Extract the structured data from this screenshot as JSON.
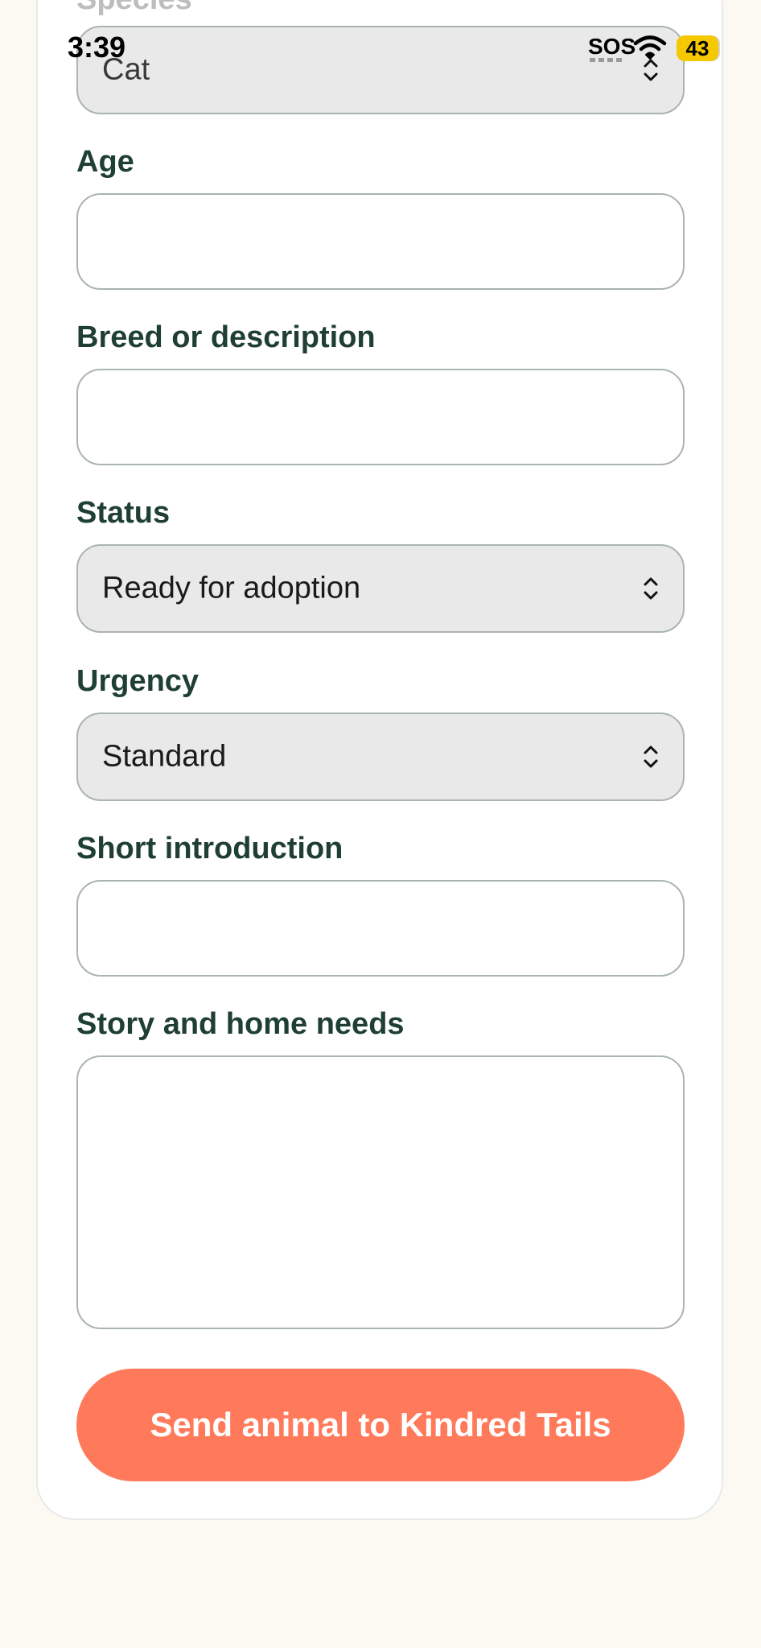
{
  "status_bar": {
    "time": "3:39",
    "sos": "SOS",
    "battery": "43"
  },
  "form": {
    "species": {
      "label": "Species",
      "value": "Cat"
    },
    "age": {
      "label": "Age",
      "value": ""
    },
    "breed": {
      "label": "Breed or description",
      "value": ""
    },
    "status": {
      "label": "Status",
      "value": "Ready for adoption"
    },
    "urgency": {
      "label": "Urgency",
      "value": "Standard"
    },
    "intro": {
      "label": "Short introduction",
      "value": ""
    },
    "story": {
      "label": "Story and home needs",
      "value": ""
    },
    "submit_label": "Send animal to Kindred Tails"
  },
  "colors": {
    "accent": "#ff7a5a",
    "label": "#1f3f36",
    "page_bg": "#fcf8f2"
  }
}
